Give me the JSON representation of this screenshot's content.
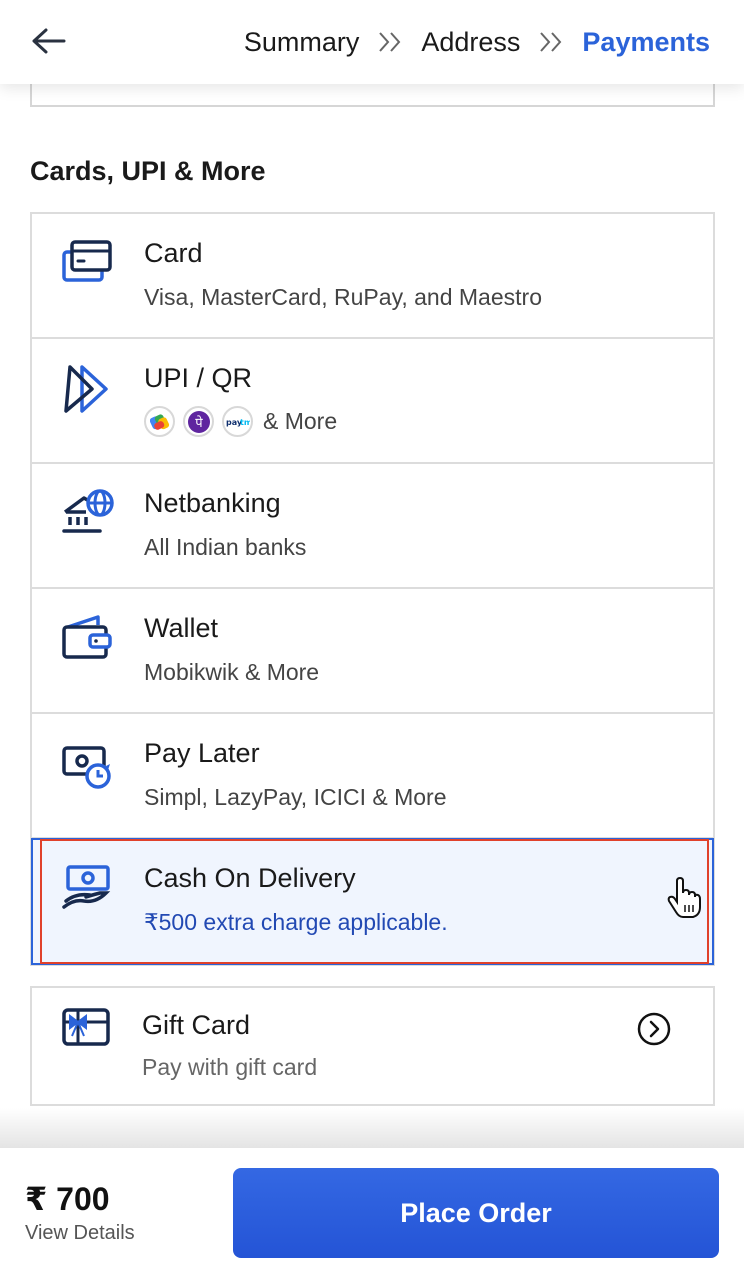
{
  "header": {
    "back_icon": "arrow-left-icon",
    "breadcrumb": [
      {
        "label": "Summary",
        "active": false
      },
      {
        "label": "Address",
        "active": false
      },
      {
        "label": "Payments",
        "active": true
      }
    ],
    "separator_icon": "double-chevron-right-icon"
  },
  "sections": {
    "cards_upi_title": "Cards, UPI & More",
    "gift_title": "Gift Card"
  },
  "payment_methods": [
    {
      "title": "Card",
      "subtitle": "Visa, MasterCard, RuPay, and Maestro",
      "icon": "credit-card-icon"
    },
    {
      "title": "UPI / QR",
      "subtitle": "& More",
      "icon": "upi-icon",
      "logos": [
        "google-pay-logo",
        "phonepe-logo",
        "paytm-logo"
      ]
    },
    {
      "title": "Netbanking",
      "subtitle": "All Indian banks",
      "icon": "bank-globe-icon"
    },
    {
      "title": "Wallet",
      "subtitle": "Mobikwik & More",
      "icon": "wallet-icon"
    },
    {
      "title": "Pay Later",
      "subtitle": "Simpl, LazyPay, ICICI & More",
      "icon": "cash-clock-icon"
    },
    {
      "title": "Cash On Delivery",
      "subtitle": "₹500 extra charge applicable.",
      "icon": "cash-hand-icon",
      "selected": true
    }
  ],
  "gift_card": {
    "title": "Gift Card",
    "subtitle": "Pay with gift card",
    "icon": "gift-card-icon",
    "action_icon": "chevron-right-circle-icon"
  },
  "footer": {
    "price": "₹ 700",
    "view_details": "View Details",
    "place_order": "Place Order"
  },
  "colors": {
    "accent": "#2b63d9",
    "selected_bg": "#f0f5fe",
    "highlight": "#e0412b",
    "button": "#2b5fdf"
  }
}
